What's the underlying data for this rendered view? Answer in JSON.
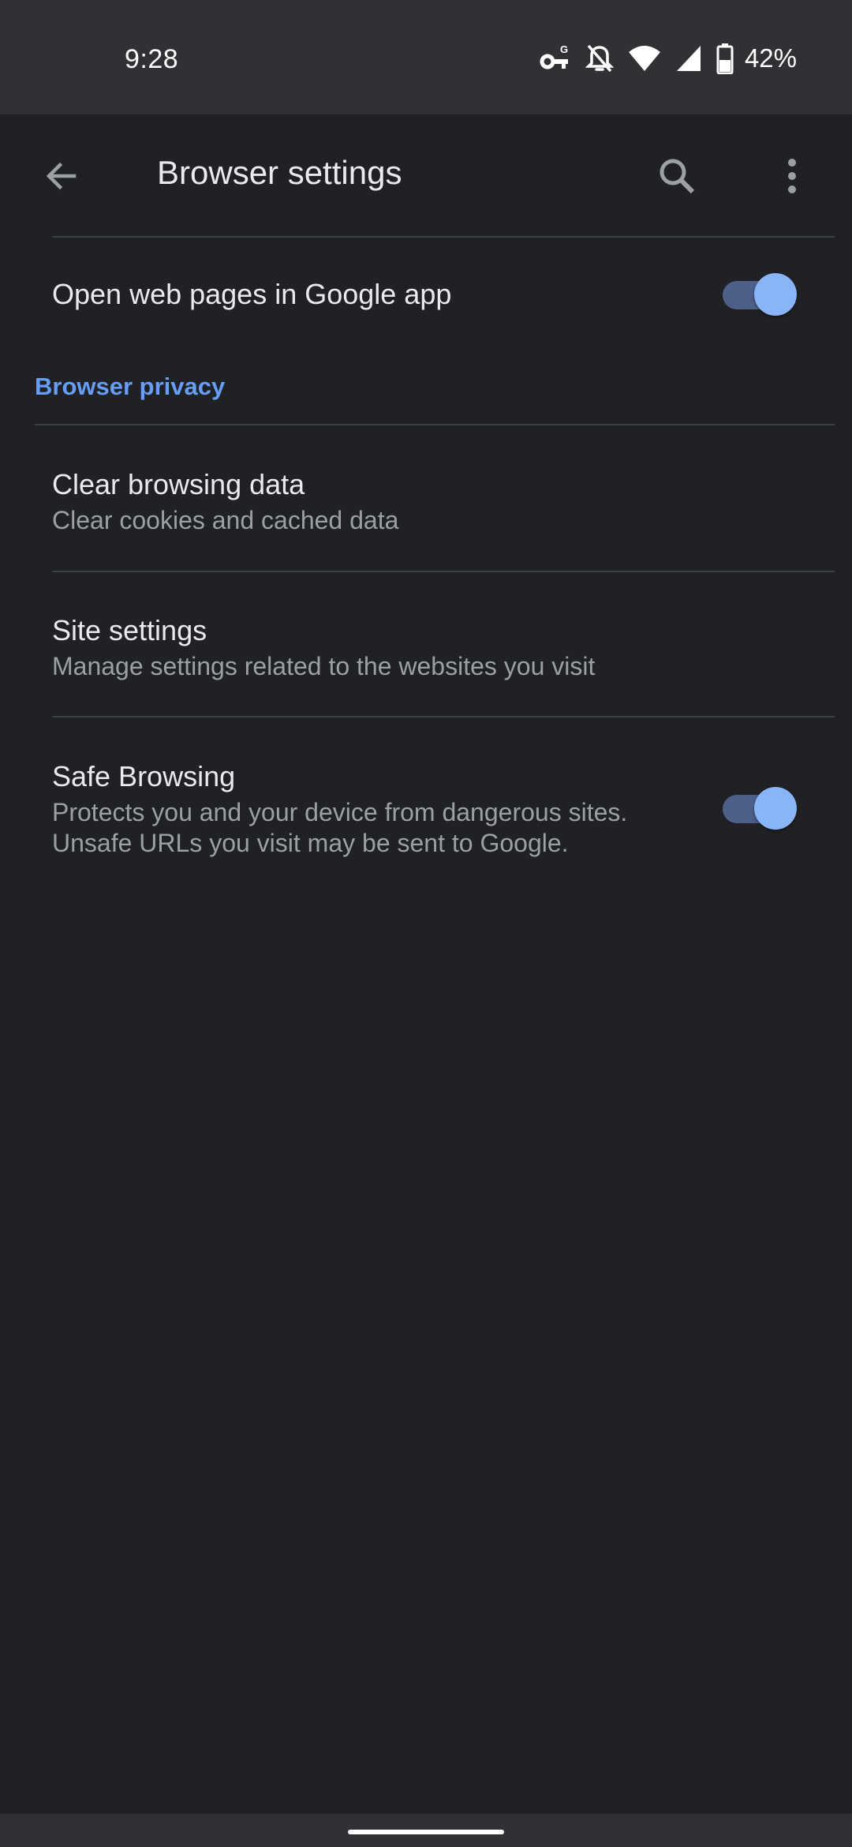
{
  "status_bar": {
    "time": "9:28",
    "battery_percent": "42%",
    "icons": [
      "vpn-key-icon",
      "notifications-off-icon",
      "wifi-icon",
      "cellular-signal-icon",
      "battery-icon"
    ]
  },
  "app_bar": {
    "title": "Browser settings",
    "back_icon": "arrow-back-icon",
    "search_icon": "search-icon",
    "more_icon": "more-vert-icon"
  },
  "settings": {
    "open_in_app": {
      "title": "Open web pages in Google app",
      "enabled": true
    },
    "privacy_header": "Browser privacy",
    "clear_data": {
      "title": "Clear browsing data",
      "summary": "Clear cookies and cached data"
    },
    "site_settings": {
      "title": "Site settings",
      "summary": "Manage settings related to the websites you visit"
    },
    "safe_browsing": {
      "title": "Safe Browsing",
      "summary_line1": "Protects you and your device from dangerous sites.",
      "summary_line2": "Unsafe URLs you visit may be sent to Google.",
      "enabled": true
    }
  },
  "colors": {
    "background": "#202124",
    "status_bar": "#303134",
    "accent": "#8ab4f8",
    "section_header": "#669df6",
    "primary_text": "#e8eaed",
    "secondary_text": "#9aa0a6"
  }
}
